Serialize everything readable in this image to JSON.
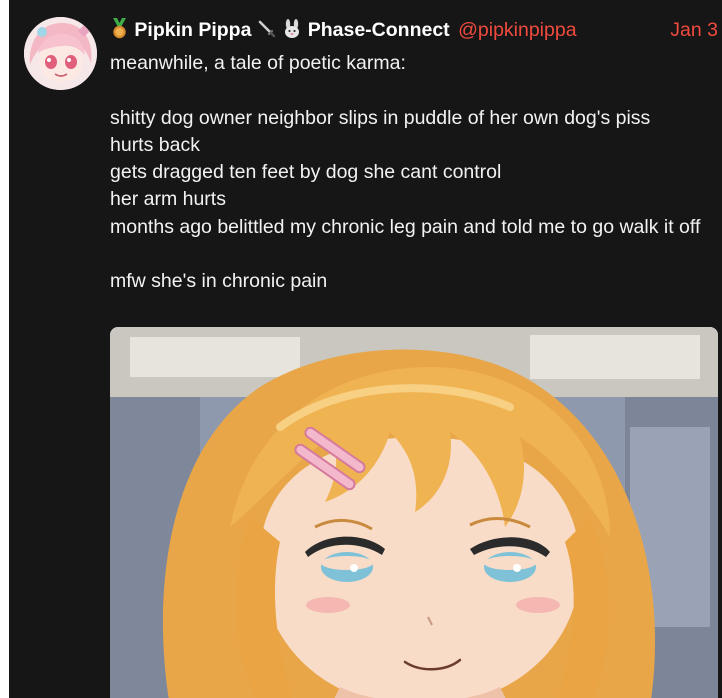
{
  "post": {
    "display_name": "Pipkin Pippa",
    "organization": "Phase-Connect",
    "handle": "@pipkinpippa",
    "date": "Jan 3",
    "lines": [
      "meanwhile, a tale of poetic karma:",
      "",
      "shitty dog owner neighbor slips in puddle of her own dog's piss",
      "hurts back",
      "gets dragged ten feet by dog she cant control",
      "her arm hurts",
      "months ago belittled my chronic leg pain and told me to go walk it off",
      "",
      "mfw she's in chronic pain"
    ],
    "icons": {
      "before_name": "medal-icon",
      "after_name_1": "sword-icon",
      "after_name_2": "rabbit-icon"
    },
    "colors": {
      "background": "#161616",
      "text": "#f2f2f2",
      "accent": "#f04a3e"
    }
  }
}
